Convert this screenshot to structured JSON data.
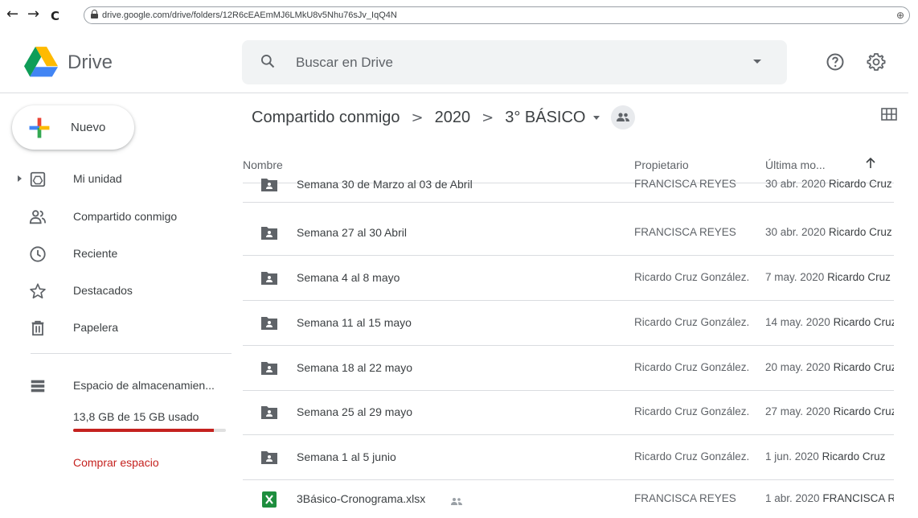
{
  "browser": {
    "back_glyph": "←",
    "forward_glyph": "→",
    "reload_glyph": "C",
    "url": "drive.google.com/drive/folders/12R6cEAEmMJ6LMkU8v5Nhu76sJv_IqQ4N",
    "zoom_glyph": "⊕"
  },
  "app": {
    "name": "Drive",
    "search_placeholder": "Buscar en Drive"
  },
  "sidebar": {
    "new_label": "Nuevo",
    "items": [
      {
        "label": "Mi unidad",
        "icon": "my-drive-icon"
      },
      {
        "label": "Compartido conmigo",
        "icon": "shared-people-icon"
      },
      {
        "label": "Reciente",
        "icon": "clock-icon"
      },
      {
        "label": "Destacados",
        "icon": "star-icon"
      },
      {
        "label": "Papelera",
        "icon": "trash-icon"
      }
    ],
    "storage": {
      "label": "Espacio de almacenamien...",
      "usage": "13,8 GB de 15 GB usado",
      "used_fraction": 0.92,
      "buy_label": "Comprar espacio"
    }
  },
  "breadcrumb": {
    "items": [
      "Compartido conmigo",
      "2020",
      "3° BÁSICO"
    ],
    "separator": ">"
  },
  "columns": {
    "name": "Nombre",
    "owner": "Propietario",
    "modified": "Última mo..."
  },
  "files": [
    {
      "name": "Semana 30 de Marzo al 03 de Abril",
      "type": "shared-folder",
      "owner": "FRANCISCA REYES",
      "date": "30 abr. 2020",
      "modified_by": "Ricardo Cruz"
    },
    {
      "name": "Semana 27 al 30 Abril",
      "type": "shared-folder",
      "owner": "FRANCISCA REYES",
      "date": "30 abr. 2020",
      "modified_by": "Ricardo Cruz"
    },
    {
      "name": "Semana 4 al 8 mayo",
      "type": "shared-folder",
      "owner": "Ricardo Cruz González.",
      "date": "7 may. 2020",
      "modified_by": "Ricardo Cruz"
    },
    {
      "name": "Semana 11 al 15 mayo",
      "type": "shared-folder",
      "owner": "Ricardo Cruz González.",
      "date": "14 may. 2020",
      "modified_by": "Ricardo Cruz"
    },
    {
      "name": "Semana 18 al 22 mayo",
      "type": "shared-folder",
      "owner": "Ricardo Cruz González.",
      "date": "20 may. 2020",
      "modified_by": "Ricardo Cruz"
    },
    {
      "name": "Semana 25 al 29 mayo",
      "type": "shared-folder",
      "owner": "Ricardo Cruz González.",
      "date": "27 may. 2020",
      "modified_by": "Ricardo Cruz"
    },
    {
      "name": "Semana 1 al 5 junio",
      "type": "shared-folder",
      "owner": "Ricardo Cruz González.",
      "date": "1 jun. 2020",
      "modified_by": "Ricardo Cruz"
    },
    {
      "name": "3Básico-Cronograma.xlsx",
      "type": "excel",
      "owner": "FRANCISCA REYES",
      "date": "1 abr. 2020",
      "modified_by": "FRANCISCA REYES",
      "shared": true
    }
  ],
  "colors": {
    "storage_bar": "#c5221f",
    "excel_green": "#1e8e3e",
    "folder_gray": "#5f6368",
    "search_bg": "#f1f3f4"
  }
}
